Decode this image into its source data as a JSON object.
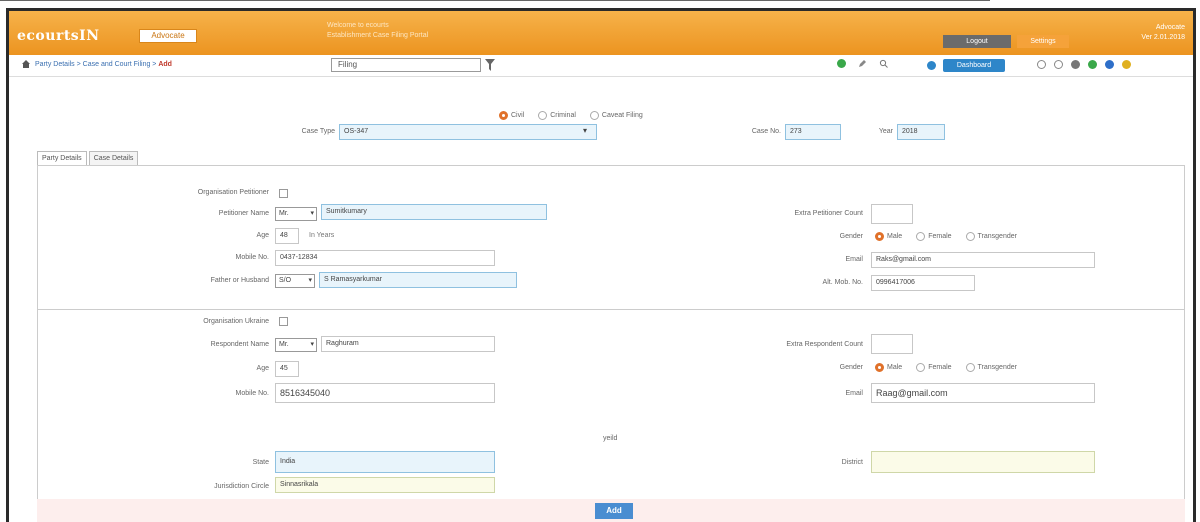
{
  "header": {
    "logo": "ecourtsIN",
    "sub_badge": "Advocate",
    "banner_line1": "Welcome to ecourts",
    "banner_line2": "Establishment Case Filing Portal",
    "btn_dark": "Logout",
    "btn_orange": "Settings",
    "user_line1": "Advocate",
    "user_line2": "Ver 2.01.2018"
  },
  "breadcrumb": {
    "path": "Party Details > Case and Court Filing > ",
    "current": "Add",
    "filter_value": "Filing",
    "blue_button": "Dashboard"
  },
  "case_filter": {
    "radios": [
      {
        "label": "Civil",
        "checked": true
      },
      {
        "label": "Criminal",
        "checked": false
      },
      {
        "label": "Caveat Filing",
        "checked": false
      }
    ],
    "case_type_label": "Case Type",
    "case_type_value": "OS-347",
    "case_no_label": "Case No.",
    "case_no_value": "273",
    "year_label": "Year",
    "year_value": "2018"
  },
  "tabs": [
    {
      "label": "Party Details",
      "active": true
    },
    {
      "label": "Case Details",
      "active": false
    }
  ],
  "petitioner": {
    "org_label": "Organisation Petitioner",
    "name_label": "Petitioner Name",
    "salutation": "Mr.",
    "name_value": "Sumitkumary",
    "age_label": "Age",
    "age_value": "48",
    "age_unit": "In Years",
    "mobile_label": "Mobile No.",
    "mobile_value": "0437-12834",
    "father_label": "Father or Husband",
    "relation": "S/O",
    "father_value": "S Ramasyarkumar",
    "extra_count_label": "Extra Petitioner Count",
    "gender_label": "Gender",
    "gender_options": [
      {
        "label": "Male",
        "checked": true
      },
      {
        "label": "Female",
        "checked": false
      },
      {
        "label": "Transgender",
        "checked": false
      }
    ],
    "email_label": "Email",
    "email_value": "Raks@gmail.com",
    "alt_mobile_label": "Alt. Mob. No.",
    "alt_mobile_value": "0996417006"
  },
  "respondent": {
    "org_label": "Organisation Ukraine",
    "name_label": "Respondent Name",
    "salutation": "Mr.",
    "name_value": "Raghuram",
    "age_label": "Age",
    "age_value": "45",
    "mobile_label": "Mobile No.",
    "mobile_value": "8516345040",
    "extra_count_label": "Extra Respondent Count",
    "gender_label": "Gender",
    "gender_options": [
      {
        "label": "Male",
        "checked": true
      },
      {
        "label": "Female",
        "checked": false
      },
      {
        "label": "Transgender",
        "checked": false
      }
    ],
    "email_label": "Email",
    "email_value": "Raag@gmail.com"
  },
  "extra": {
    "center_label": "yeild",
    "state_label": "State",
    "state_value": "India",
    "district_label": "District",
    "district_value": "",
    "field_label": "Jurisdiction Circle",
    "field_value": "Sinnasrikala"
  },
  "submit_label": "Add",
  "colors": {
    "header_orange": "#ec9420",
    "accent_blue": "#2e86c9",
    "radio_orange": "#e0712a",
    "field_blue": "#e8f4fb"
  }
}
